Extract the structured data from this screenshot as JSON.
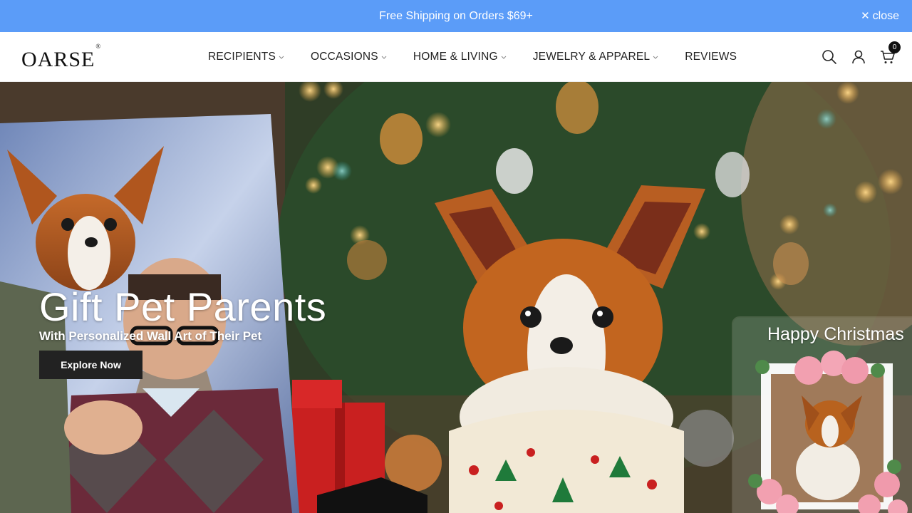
{
  "announcement": {
    "text": "Free Shipping on Orders $69+",
    "close_label": "close"
  },
  "header": {
    "logo": "OARSE",
    "logo_mark": "®",
    "nav": [
      {
        "label": "RECIPIENTS",
        "has_dropdown": true
      },
      {
        "label": "OCCASIONS",
        "has_dropdown": true
      },
      {
        "label": "HOME & LIVING",
        "has_dropdown": true
      },
      {
        "label": "JEWELRY & APPAREL",
        "has_dropdown": true
      },
      {
        "label": "REVIEWS",
        "has_dropdown": false
      }
    ],
    "icons": [
      "search-icon",
      "account-icon",
      "cart-icon"
    ],
    "cart_count": "0"
  },
  "hero": {
    "title": "Gift Pet Parents",
    "subtitle": "With Personalized Wall Art of Their Pet",
    "cta_label": "Explore Now",
    "frame_text": "Happy Christmas"
  },
  "colors": {
    "announcement_bg": "#5b9cf8",
    "button_bg": "#222222",
    "text_dark": "#222222"
  }
}
